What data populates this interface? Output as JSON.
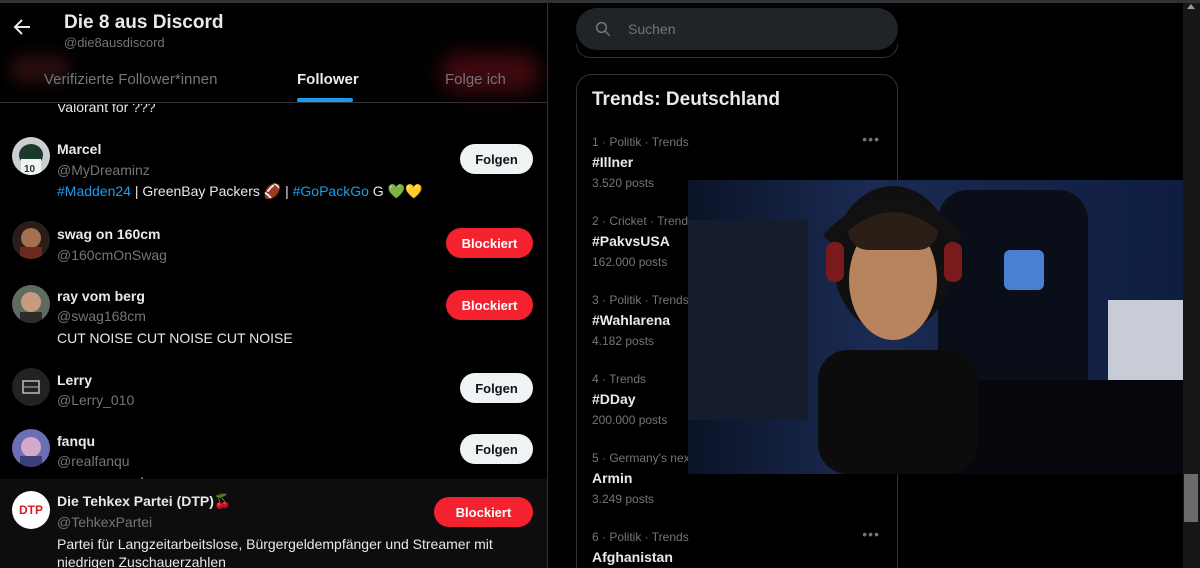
{
  "header": {
    "title": "Die 8 aus Discord",
    "handle": "@die8ausdiscord",
    "tabs": [
      "Verifizierte Follower*innen",
      "Follower",
      "Folge ich"
    ]
  },
  "partial_bio": "Valorant for ???",
  "followers": [
    {
      "name": "Marcel",
      "handle": "@MyDreaminz",
      "bio_parts": [
        {
          "text": "#Madden24",
          "link": true
        },
        {
          "text": " | GreenBay Packers 🏈 | ",
          "link": false
        },
        {
          "text": "#GoPackGo",
          "link": true
        },
        {
          "text": " G 💚💛",
          "link": false
        }
      ],
      "button": "Folgen"
    },
    {
      "name": "swag on 160cm",
      "handle": "@160cmOnSwag",
      "button": "Blockiert"
    },
    {
      "name": "ray vom berg",
      "handle": "@swag168cm",
      "bio": "CUT NOISE CUT NOISE CUT NOISE",
      "button": "Blockiert"
    },
    {
      "name": "Lerry",
      "handle": "@Lerry_010",
      "button": "Folgen"
    },
    {
      "name": "fanqu",
      "handle": "@realfanqu",
      "button": "Folgen"
    },
    {
      "name": "Die Tehkex Partei (DTP)🍒",
      "handle": "@TehkexPartei",
      "avatar_text": "DTP",
      "bio_line1": "Partei für Langzeitarbeitslose, Bürgergeldempfänger und Streamer mit",
      "bio_line2": "niedrigen Zuschauerzahlen",
      "button": "Blockiert"
    }
  ],
  "search": {
    "placeholder": "Suchen"
  },
  "trends": {
    "title": "Trends: Deutschland",
    "items": [
      {
        "meta": "1 · Politik · Trends",
        "name": "#Illner",
        "posts": "3.520 posts"
      },
      {
        "meta": "2 · Cricket · Trends",
        "name": "#PakvsUSA",
        "posts": "162.000 posts"
      },
      {
        "meta": "3 · Politik · Trends",
        "name": "#Wahlarena",
        "posts": "4.182 posts"
      },
      {
        "meta": "4 · Trends",
        "name": "#DDay",
        "posts": "200.000 posts"
      },
      {
        "meta": "5 · Germany's next",
        "name": "Armin",
        "posts": "3.249 posts"
      },
      {
        "meta": "6 · Politik · Trends",
        "name": "Afghanistan",
        "posts": ""
      }
    ]
  },
  "colors": {
    "accent": "#1d9bf0",
    "blocked": "#f4212e",
    "background": "#000000"
  }
}
